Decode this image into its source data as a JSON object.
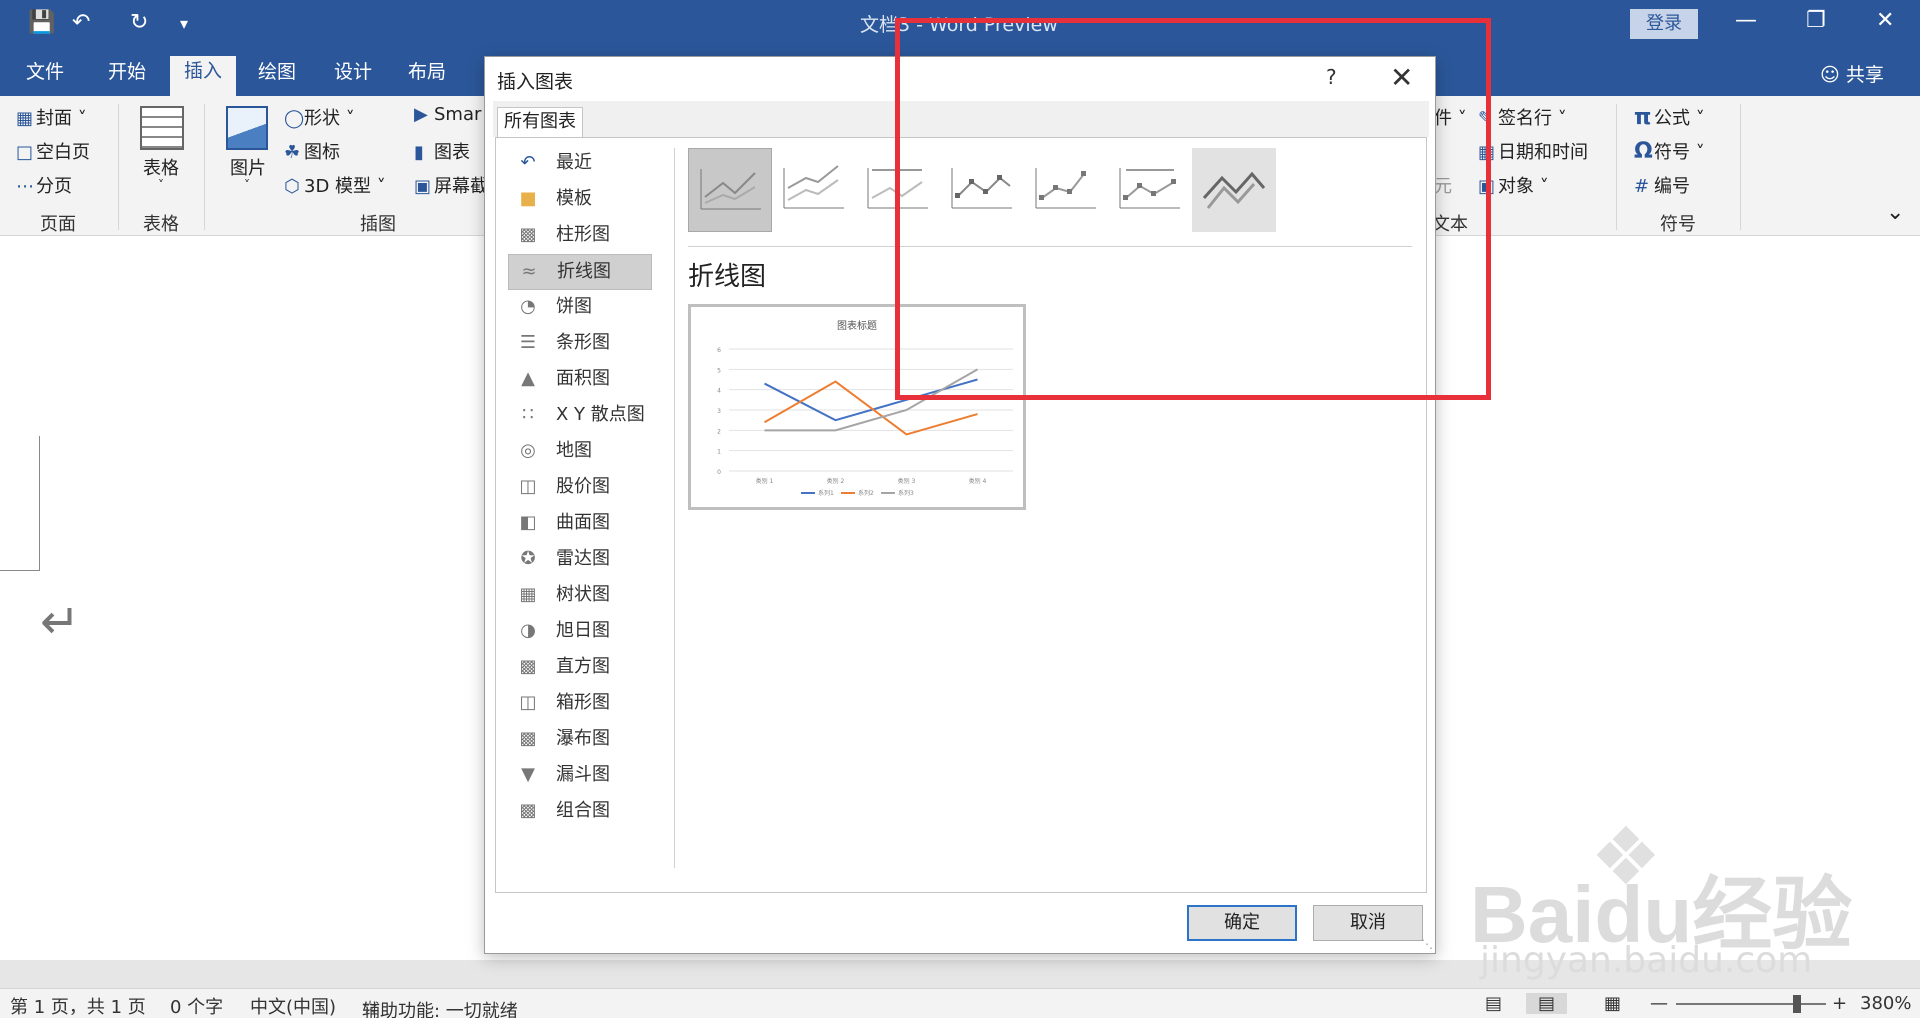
{
  "titlebar": {
    "title": "文档3 - Word Preview",
    "login": "登录",
    "quick_access": [
      "save-icon",
      "undo-icon",
      "redo-icon",
      "customize-icon"
    ]
  },
  "tabs": [
    "文件",
    "开始",
    "插入",
    "绘图",
    "设计",
    "布局"
  ],
  "share": "共享",
  "ribbon": {
    "pages": {
      "cover": "封面",
      "blank": "空白页",
      "break": "分页",
      "label": "页面"
    },
    "table": {
      "table": "表格",
      "label": "表格"
    },
    "illustrations": {
      "picture": "图片",
      "shapes": "形状",
      "icons": "图标",
      "model3d": "3D 模型",
      "smartart": "Smar",
      "chart": "图表",
      "screenshot": "屏幕截",
      "label": "插图"
    },
    "text": {
      "partial1": "件",
      "partial2": "元",
      "signature": "签名行",
      "datetime": "日期和时间",
      "object": "对象",
      "label": "文本"
    },
    "symbols": {
      "equation": "公式",
      "symbol": "符号",
      "number": "编号",
      "label": "符号"
    }
  },
  "dialog": {
    "title": "插入图表",
    "help": "?",
    "tab": "所有图表",
    "categories": [
      "最近",
      "模板",
      "柱形图",
      "折线图",
      "饼图",
      "条形图",
      "面积图",
      "X Y 散点图",
      "地图",
      "股价图",
      "曲面图",
      "雷达图",
      "树状图",
      "旭日图",
      "直方图",
      "箱形图",
      "瀑布图",
      "漏斗图",
      "组合图"
    ],
    "selected_category": "折线图",
    "section_title": "折线图",
    "ok": "确定",
    "cancel": "取消"
  },
  "preview": {
    "title": "图表标题",
    "y_ticks": [
      "0",
      "1",
      "2",
      "3",
      "4",
      "5",
      "6"
    ],
    "categories": [
      "类别 1",
      "类别 2",
      "类别 3",
      "类别 4"
    ],
    "legend": [
      "系列1",
      "系列2",
      "系列3"
    ]
  },
  "chart_data": {
    "type": "line",
    "title": "图表标题",
    "categories": [
      "类别 1",
      "类别 2",
      "类别 3",
      "类别 4"
    ],
    "series": [
      {
        "name": "系列1",
        "values": [
          4.3,
          2.5,
          3.5,
          4.5
        ],
        "color": "#4472c4"
      },
      {
        "name": "系列2",
        "values": [
          2.4,
          4.4,
          1.8,
          2.8
        ],
        "color": "#ed7d31"
      },
      {
        "name": "系列3",
        "values": [
          2,
          2,
          3,
          5
        ],
        "color": "#a5a5a5"
      }
    ],
    "ylim": [
      0,
      6
    ],
    "grid": true,
    "legend_position": "bottom"
  },
  "status": {
    "page": "第 1 页，共 1 页",
    "words": "0 个字",
    "language": "中文(中国)",
    "accessibility": "辅助功能: 一切就绪",
    "zoom": "380%"
  },
  "watermark": {
    "brand": "Baidu经验",
    "url": "jingyan.baidu.com"
  }
}
